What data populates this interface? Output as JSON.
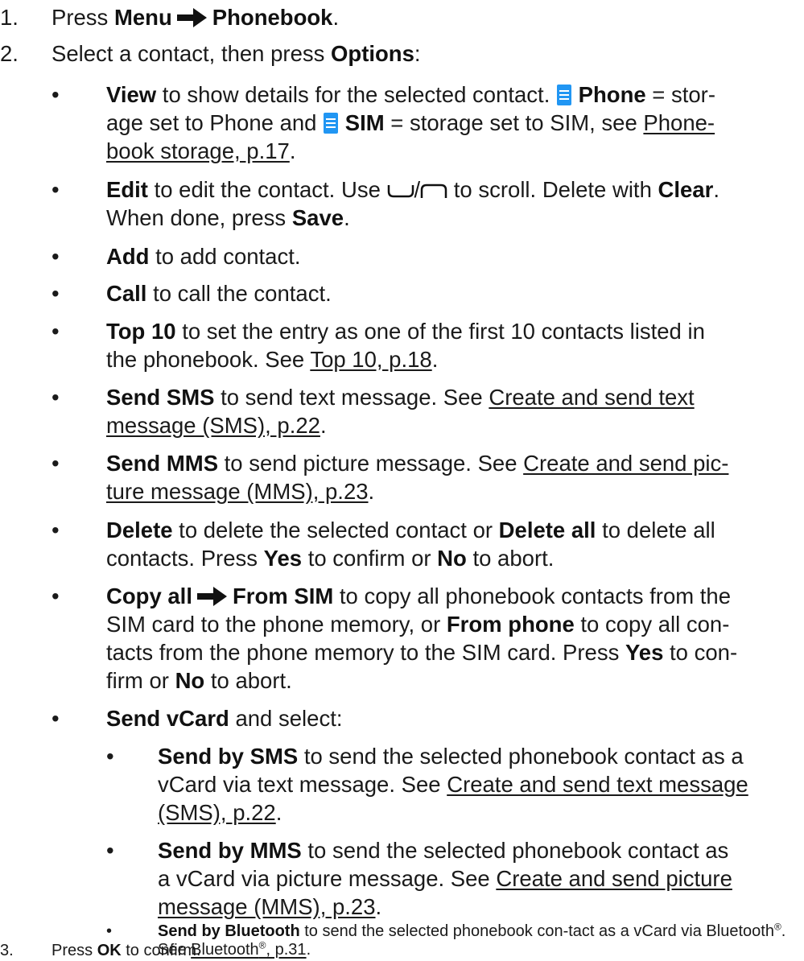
{
  "steps": {
    "s1": {
      "num": "1.",
      "pre": "Press ",
      "b1": "Menu",
      "b2": "Phonebook",
      "post": "."
    },
    "s2": {
      "num": "2.",
      "pre": "Select a contact, then press ",
      "b1": "Options",
      "post": ":"
    },
    "s3": {
      "num": "3.",
      "pre": "Press ",
      "b1": "OK",
      "post": " to confirm."
    }
  },
  "options": {
    "view": {
      "b": "View",
      "t1": " to show details for the selected contact. ",
      "phone": "Phone",
      "t2": " = stor-",
      "t3": "age set to Phone and ",
      "sim": "SIM",
      "t4": " = storage set to SIM, see ",
      "link1": "Phone-",
      "link2": "book storage, p.17",
      "t5": "."
    },
    "edit": {
      "b": "Edit",
      "t1": " to edit the contact. Use ",
      "slash": "/",
      "t2": " to scroll. Delete with ",
      "clear": "Clear",
      "t3": ".",
      "t4": "When done, press ",
      "save": "Save",
      "t5": "."
    },
    "add": {
      "b": "Add",
      "t": " to add contact."
    },
    "call": {
      "b": "Call",
      "t": " to call the contact."
    },
    "top10": {
      "b": "Top 10",
      "t1": " to set the entry as one of the first 10 contacts listed in",
      "t2": "the phonebook. See ",
      "link": "Top 10, p.18",
      "t3": "."
    },
    "sms": {
      "b": "Send SMS",
      "t1": " to send text message. See ",
      "link1": "Create and send text",
      "link2": "message (SMS), p.22",
      "t2": "."
    },
    "mms": {
      "b": "Send MMS",
      "t1": " to send picture message. See ",
      "link1": "Create and send pic-",
      "link2": "ture message (MMS), p.23",
      "t2": "."
    },
    "delete": {
      "b": "Delete",
      "t1": " to delete the selected contact or ",
      "b2": "Delete all",
      "t2": " to delete all",
      "t3": "contacts. Press ",
      "yes": "Yes",
      "t4": " to confirm or ",
      "no": "No",
      "t5": " to abort."
    },
    "copy": {
      "b": "Copy all",
      "b2": "From SIM",
      "t1": " to copy all phonebook contacts from the",
      "t2": "SIM card to the phone memory, or ",
      "b3": "From phone",
      "t3": " to copy all con-",
      "t4": "tacts from the phone memory to the SIM card. Press ",
      "yes": "Yes",
      "t5": " to con-",
      "t6": "firm or ",
      "no": "No",
      "t7": " to abort."
    },
    "vcard": {
      "b": "Send vCard",
      "t": " and select:",
      "bysms": {
        "b": "Send by SMS",
        "t1": " to send the selected phonebook contact as a",
        "t2": "vCard via text message. See ",
        "link1": "Create and send text message",
        "link2": "(SMS), p.22",
        "t3": "."
      },
      "bymms": {
        "b": "Send by MMS",
        "t1": " to send the selected phonebook contact as",
        "t2": "a vCard via picture message. See ",
        "link1": "Create and send picture",
        "link2": "message (MMS), p.23",
        "t3": "."
      },
      "bybt": {
        "b": "Send by Bluetooth",
        "t1": " to send the selected phonebook con-",
        "t2": "tact as a vCard via Bluetooth",
        "reg": "®",
        "t3": ". See ",
        "link": "Bluetooth",
        "linkreg": "®",
        "linkpage": ", p.31",
        "t4": "."
      }
    }
  },
  "bullet": "•",
  "colors": {
    "text": "#1a1a1a",
    "icon": "#2196f3"
  },
  "icons": [
    "arrow-right-icon",
    "sim-storage-icon",
    "nav-down-icon",
    "nav-up-icon"
  ]
}
